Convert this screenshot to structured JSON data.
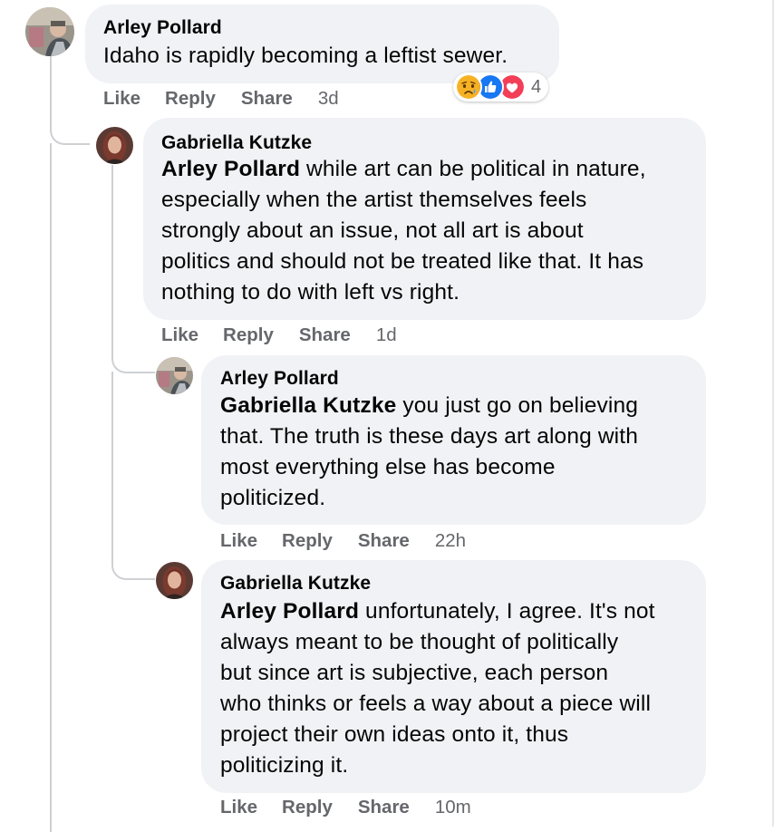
{
  "actions": {
    "like": "Like",
    "reply": "Reply",
    "share": "Share"
  },
  "comments": [
    {
      "author": "Arley Pollard",
      "mention": "",
      "text": "Idaho is rapidly becoming a leftist sewer.",
      "time": "3d",
      "reaction_count": "4",
      "reactions": [
        "sad-react-icon",
        "like-react-icon",
        "love-react-icon"
      ]
    },
    {
      "author": "Gabriella Kutzke",
      "mention": "Arley Pollard",
      "lines": [
        " while art can be political in nature,",
        "especially when the artist themselves feels",
        "strongly about an issue, not all art is about",
        "politics and should not be treated like that. It has",
        "nothing to do with left vs right."
      ],
      "time": "1d"
    },
    {
      "author": "Arley Pollard",
      "mention": "Gabriella Kutzke",
      "lines": [
        " you just go on believing",
        "that. The truth is these days art along with",
        "most everything else has become",
        "politicized."
      ],
      "time": "22h"
    },
    {
      "author": "Gabriella Kutzke",
      "mention": "Arley Pollard",
      "lines": [
        " unfortunately, I agree. It's not",
        "always meant to be thought of politically",
        "but since art is subjective, each person",
        "who thinks or feels a way about a piece will",
        "project their own ideas onto it, thus",
        "politicizing it."
      ],
      "time": "10m"
    }
  ],
  "colors": {
    "bubble": "#f0f2f5",
    "meta_text": "#65676b",
    "thread_line": "#ced0d4",
    "like_blue": "#1877f2",
    "love_red": "#f33e58",
    "sad_yellow": "#f7b125"
  }
}
